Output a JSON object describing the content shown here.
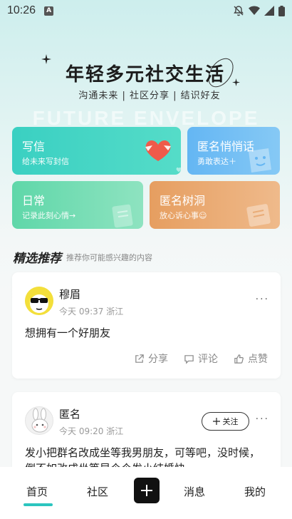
{
  "status_bar": {
    "time": "10:26",
    "app_icon": "A"
  },
  "hero": {
    "title": "年轻多元社交生活",
    "subtitle": "沟通未来 | 社区分享 | 结识好友",
    "watermark": "FUTURE ENVELOPE"
  },
  "cards": [
    {
      "title": "写信",
      "subtitle": "给未来写封信"
    },
    {
      "title": "匿名悄悄话",
      "subtitle": "勇敢表达＋"
    },
    {
      "title": "日常",
      "subtitle": "记录此刻心情→"
    },
    {
      "title": "匿名树洞",
      "subtitle": "放心诉心事☺"
    }
  ],
  "section": {
    "title": "精选推荐",
    "subtitle": "推荐你可能感兴趣的内容"
  },
  "posts": [
    {
      "name": "穆眉",
      "time": "今天 09:37",
      "location": "浙江",
      "content": "想拥有一个好朋友",
      "share_label": "分享",
      "comment_label": "评论",
      "like_label": "点赞",
      "more": "···"
    },
    {
      "name": "匿名",
      "time": "今天 09:20",
      "location": "浙江",
      "follow_label": "关注",
      "content": "发小把群名改成坐等我男朋友，可等吧，没时候，倒不如改成坐等早个个发小结婚快",
      "more": "···"
    }
  ],
  "bottom_nav": {
    "items": [
      "首页",
      "社区",
      "消息",
      "我的"
    ],
    "active": "首页",
    "accent_color": "#2cc5bf"
  },
  "colors": {
    "card_write": "#3dd3c3",
    "card_whisper": "#6ab9f2",
    "card_daily": "#6ed9ac",
    "card_treehole": "#e6a468"
  }
}
